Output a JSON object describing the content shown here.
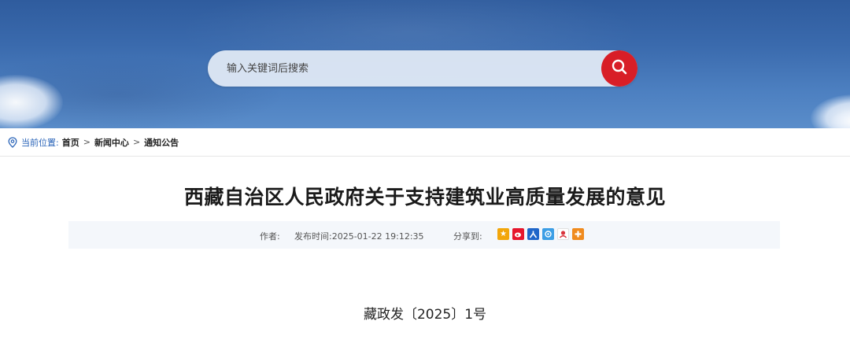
{
  "search": {
    "placeholder": "输入关键词后搜索"
  },
  "breadcrumb": {
    "label": "当前位置:",
    "items": [
      "首页",
      "新闻中心",
      "通知公告"
    ],
    "separator": ">"
  },
  "article": {
    "title": "西藏自治区人民政府关于支持建筑业高质量发展的意见",
    "author_label": "作者:",
    "date_label": "发布时间:",
    "date": "2025-01-22 19:12:35",
    "share_label": "分享到:",
    "doc_number": "藏政发〔2025〕1号"
  },
  "share_icons": [
    {
      "name": "qzone-icon",
      "color": "#f2a60b"
    },
    {
      "name": "weibo-icon",
      "color": "#e6162d"
    },
    {
      "name": "people-icon",
      "color": "#1f66c9"
    },
    {
      "name": "tencent-weibo-icon",
      "color": "#3c9ee5"
    },
    {
      "name": "renren-icon",
      "color": "#d9343c"
    },
    {
      "name": "more-icon",
      "color": "#f08b1e"
    }
  ],
  "colors": {
    "accent": "#d81e27",
    "link_blue": "#2a64b8",
    "banner_blue": "#3a6aad"
  }
}
